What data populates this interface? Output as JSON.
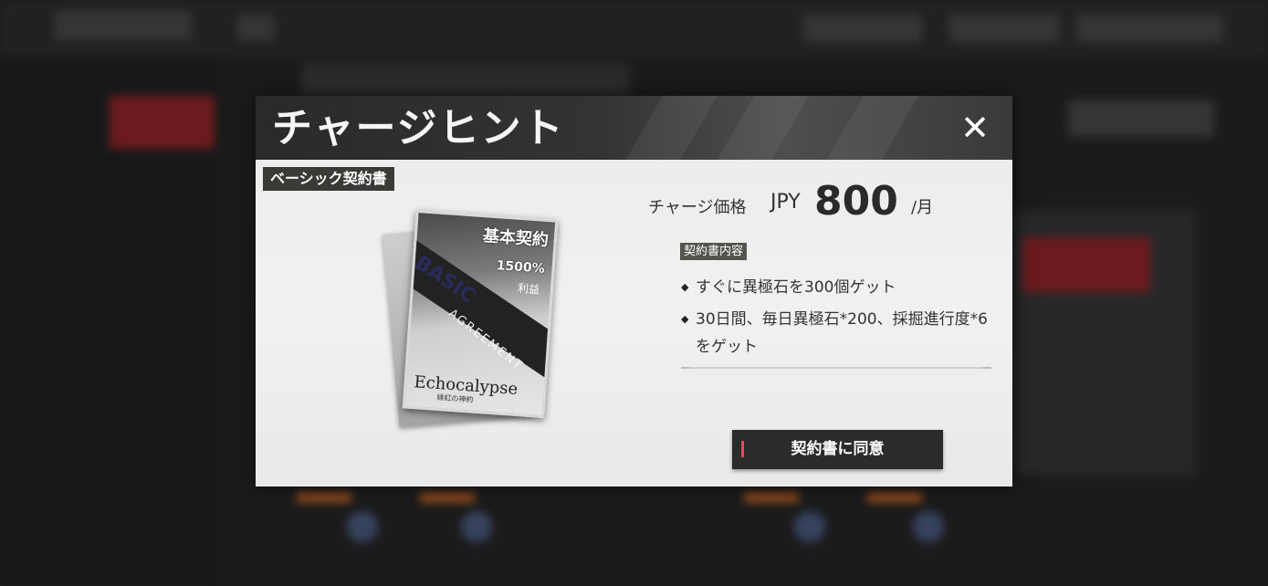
{
  "modal": {
    "title": "チャージヒント",
    "close_icon": "close-icon",
    "plan_tag": "ベーシック契約書",
    "card": {
      "title": "基本契約",
      "percent": "1500%",
      "profit": "利益",
      "basic": "BASIC",
      "agreement": "AGREEMENT",
      "logo": "Echocalypse",
      "logo_sub": "緋紅の神約"
    },
    "price": {
      "label": "チャージ価格",
      "currency": "JPY",
      "amount": "800",
      "unit": "/月"
    },
    "contents_tag": "契約書内容",
    "contents": [
      "すぐに異極石を300個ゲット",
      "30日間、毎日異極石*200、採掘進行度*6をゲット"
    ],
    "agree_button": "契約書に同意"
  },
  "colors": {
    "header_bg": "#2f2f2f",
    "panel_bg": "#efefef",
    "button_bg": "#2b2b2b",
    "button_accent": "#e44c55"
  }
}
